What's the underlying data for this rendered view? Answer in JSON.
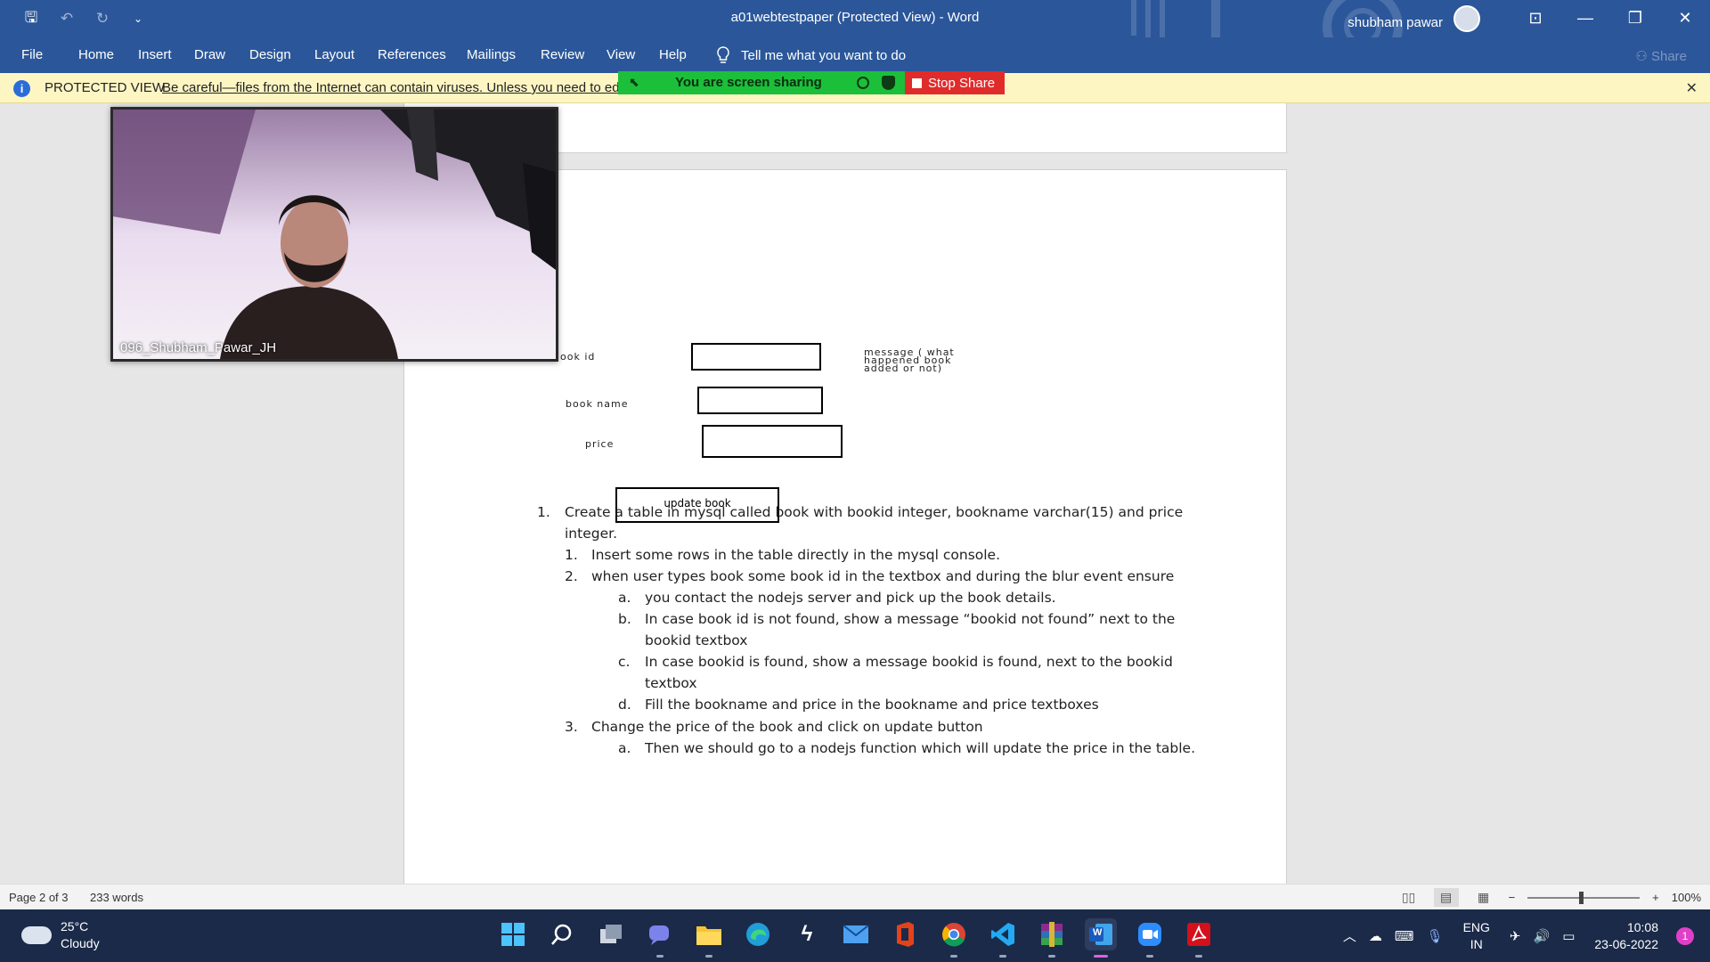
{
  "window": {
    "title": "a01webtestpaper (Protected View)  -  Word",
    "user_name": "shubham pawar",
    "min_glyph": "—",
    "restore_glyph": "❐",
    "close_glyph": "✕",
    "ribbon_display_glyph": "⊡"
  },
  "quick_access": {
    "save_glyph": "🖫",
    "undo_glyph": "↶",
    "redo_glyph": "↻",
    "customize_glyph": "⌄"
  },
  "ribbon": {
    "tabs": [
      "File",
      "Home",
      "Insert",
      "Draw",
      "Design",
      "Layout",
      "References",
      "Mailings",
      "Review",
      "View",
      "Help"
    ],
    "tell_me": "Tell me what you want to do",
    "share": "Share"
  },
  "protected_view": {
    "icon_text": "i",
    "title": "PROTECTED VIEW",
    "message": "Be careful—files from the Internet can contain viruses. Unless you need to edit",
    "close_glyph": "✕"
  },
  "screen_share": {
    "label": "You are screen sharing",
    "stop_label": "Stop Share"
  },
  "webcam": {
    "participant": "096_Shubham_Pawar_JH"
  },
  "form_mock": {
    "book_id_label": "ook id",
    "book_name_label": "book name",
    "price_label": "price",
    "message_label_1": "message ( what",
    "message_label_2": "happened book",
    "message_label_3": "added or not)",
    "button_label": "update book"
  },
  "document_list": [
    {
      "marker": "1.",
      "text": "Create a table in mysql called book with bookid integer, bookname varchar(15) and price"
    },
    {
      "marker": "",
      "text": "integer."
    },
    {
      "marker": "1.",
      "text": "Insert some rows in the table directly in the mysql console."
    },
    {
      "marker": "2.",
      "text": "when user types book some book id in the textbox and during the blur event ensure"
    },
    {
      "marker": "a.",
      "text": "you contact the nodejs server and pick up the book details."
    },
    {
      "marker": "b.",
      "text": "In case book id is not found, show a message “bookid not found” next to the"
    },
    {
      "marker": "",
      "text": "bookid textbox"
    },
    {
      "marker": "c.",
      "text": "In case bookid is found, show a message bookid is found, next to the bookid"
    },
    {
      "marker": "",
      "text": "textbox"
    },
    {
      "marker": "d.",
      "text": "Fill the bookname and price in the bookname and price textboxes"
    },
    {
      "marker": "3.",
      "text": "Change the price of the book and click on update button"
    },
    {
      "marker": "a.",
      "text": "Then we should go to a nodejs function which will update the price in the table."
    }
  ],
  "status_bar": {
    "page": "Page 2 of 3",
    "words": "233 words",
    "zoom": "100%",
    "zoom_out": "−",
    "zoom_in": "+"
  },
  "taskbar": {
    "weather_temp": "25°C",
    "weather_desc": "Cloudy",
    "language_1": "ENG",
    "language_2": "IN",
    "time": "10:08",
    "date": "23-06-2022",
    "notification_count": "1",
    "word_glyph": "W"
  },
  "colors": {
    "word_blue": "#2b579a",
    "protected_yellow": "#fdf6c3",
    "share_green": "#1cbf3a",
    "stop_red": "#e02b2b",
    "taskbar": "#1b2a49"
  }
}
